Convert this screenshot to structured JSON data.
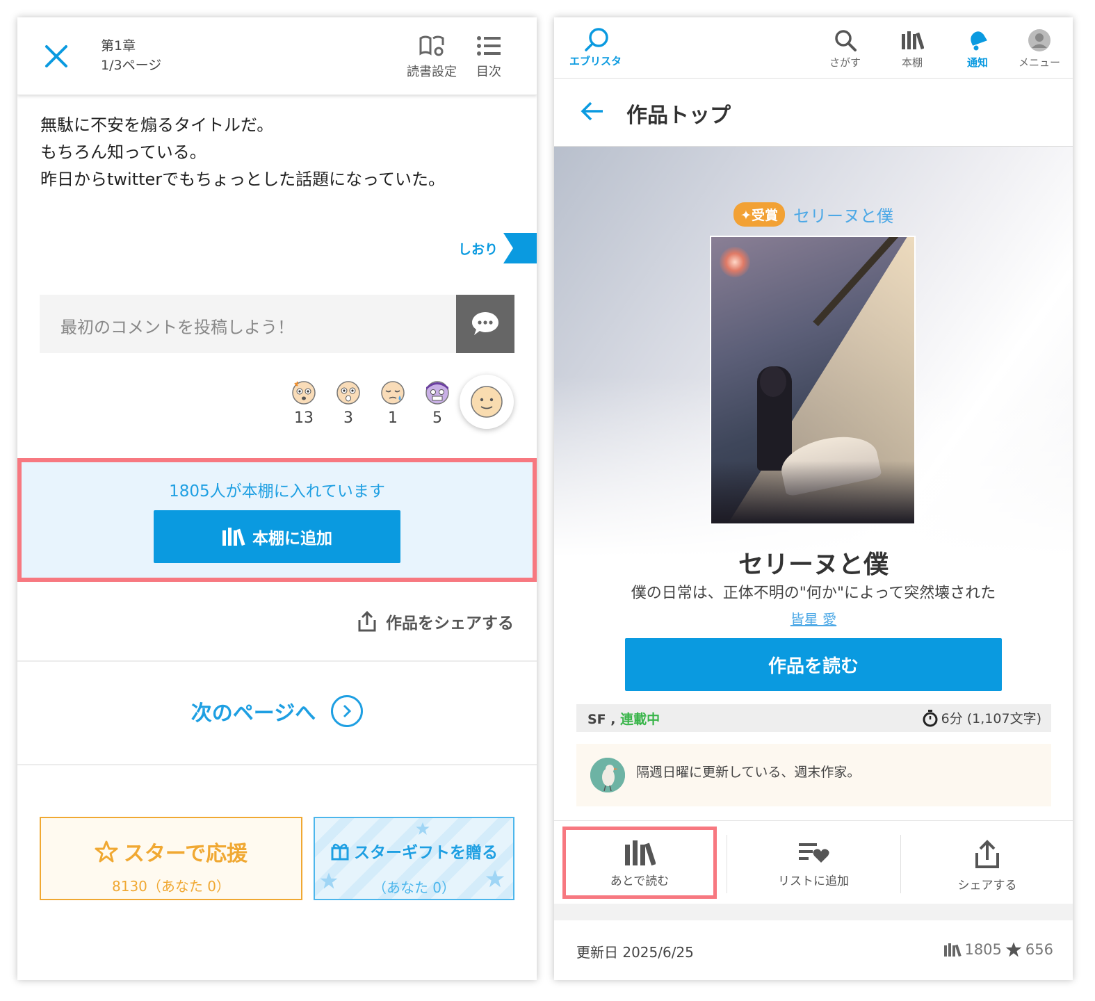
{
  "reader": {
    "chapter": "第1章",
    "page": "1/3ページ",
    "settings_label": "読書設定",
    "toc_label": "目次",
    "text_lines": [
      "無駄に不安を煽るタイトルだ。",
      "もちろん知っている。",
      "昨日からtwitterでもちょっとした話題になっていた。"
    ],
    "bookmark_label": "しおり",
    "comment_placeholder": "最初のコメントを投稿しよう！",
    "reactions": [
      {
        "icon": "surprised-face-icon",
        "count": "13"
      },
      {
        "icon": "shocked-face-icon",
        "count": "3"
      },
      {
        "icon": "sad-face-icon",
        "count": "1"
      },
      {
        "icon": "scared-face-icon",
        "count": "5"
      }
    ],
    "bookshelf_count": "1805人が本棚に入れています",
    "bookshelf_button": "本棚に追加",
    "share_label": "作品をシェアする",
    "next_page": "次のページへ",
    "star_title": "スターで応援",
    "star_sub": "8130（あなた 0）",
    "gift_title": "スターギフトを贈る",
    "gift_sub": "（あなた 0）"
  },
  "site": {
    "logo": "エブリスタ",
    "nav": [
      {
        "label": "さがす",
        "icon": "search-icon"
      },
      {
        "label": "本棚",
        "icon": "bookshelf-icon"
      },
      {
        "label": "通知",
        "icon": "bell-icon"
      },
      {
        "label": "メニュー",
        "icon": "user-icon"
      }
    ],
    "page_title": "作品トップ"
  },
  "work": {
    "award_badge": "✦受賞",
    "title_small": "セリーヌと僕",
    "title": "セリーヌと僕",
    "catchphrase": "僕の日常は、正体不明の\"何か\"によって突然壊された",
    "author": "皆星 愛",
    "read_button": "作品を読む",
    "genre": "SF",
    "genre_sep": " , ",
    "status": "連載中",
    "read_time": "6分 (1,107文字)",
    "author_message": "隔週日曜に更新している、週末作家。",
    "actions": [
      {
        "label": "あとで読む",
        "icon": "bookshelf-icon"
      },
      {
        "label": "リストに追加",
        "icon": "list-heart-icon"
      },
      {
        "label": "シェアする",
        "icon": "share-icon"
      }
    ],
    "updated": "更新日 2025/6/25",
    "bookshelf_total": "1805",
    "stars_total": "656"
  },
  "colors": {
    "accent": "#0a9ae0",
    "highlight": "#f77880",
    "star": "#f0a832",
    "status_green": "#39b54a"
  }
}
